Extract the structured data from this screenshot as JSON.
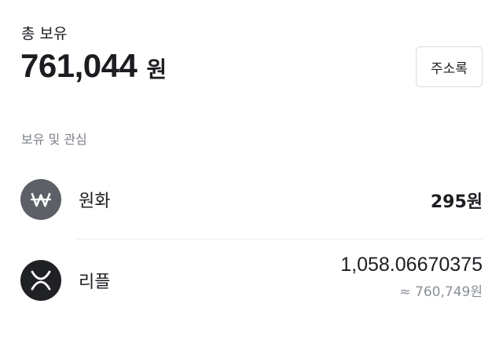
{
  "header": {
    "total_label": "총 보유",
    "total_amount": "761,044",
    "total_unit": "원",
    "address_button_label": "주소록"
  },
  "holdings": {
    "section_title": "보유 및 관심",
    "items": [
      {
        "name": "원화",
        "icon": "won-icon",
        "value": "295원"
      },
      {
        "name": "리플",
        "icon": "xrp-icon",
        "amount": "1,058.06670375",
        "approx_value": "≈ 760,749원"
      }
    ]
  },
  "colors": {
    "text_primary": "#1b1d21",
    "text_secondary": "#7a7f87",
    "krw_icon_bg": "#5d6066",
    "xrp_icon_bg": "#1f2124",
    "divider": "#e9eaec"
  }
}
